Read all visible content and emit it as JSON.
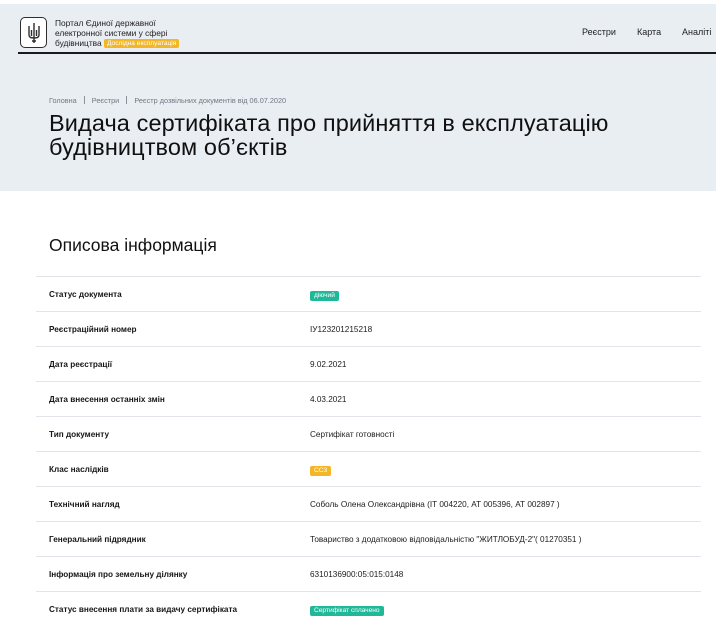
{
  "header": {
    "brand_line1": "Портал Єдиної державної",
    "brand_line2": "електронної системи у сфері",
    "brand_line3": "будівництва",
    "brand_badge": "Дослідна експлуатація",
    "nav": [
      "Реєстри",
      "Карта",
      "Аналіті"
    ],
    "logo_icon": "trident-icon"
  },
  "breadcrumbs": [
    "Головна",
    "Реєстри",
    "Реєстр дозвільних документів від 06.07.2020"
  ],
  "page_title": "Видача сертифіката про прийняття в експлуатацію будівництвом об’єктів",
  "section_title": "Описова інформація",
  "rows": [
    {
      "label": "Статус документа",
      "value": "діючий",
      "chip_color": "#1fb99a"
    },
    {
      "label": "Реєстраційний номер",
      "value": "ІУ123201215218"
    },
    {
      "label": "Дата реєстрації",
      "value": "9.02.2021"
    },
    {
      "label": "Дата внесення останніх змін",
      "value": "4.03.2021"
    },
    {
      "label": "Тип документу",
      "value": "Сертифікат готовності"
    },
    {
      "label": "Клас наслідків",
      "value": "СС3",
      "chip_color": "#f2b627"
    },
    {
      "label": "Технічний нагляд",
      "value": "Соболь Олена Олександрівна (ІТ 004220, АТ 005396, АТ 002897 )"
    },
    {
      "label": "Генеральний підрядник",
      "value": "Товариство з додатковою відповідальністю \"ЖИТЛОБУД-2\"( 01270351 )"
    },
    {
      "label": "Інформація про земельну ділянку",
      "value": "6310136900:05:015:0148"
    },
    {
      "label": "Статус внесення плати за видачу сертифіката",
      "value": "Сертифікат сплачено",
      "chip_color": "#1fb99a"
    }
  ]
}
